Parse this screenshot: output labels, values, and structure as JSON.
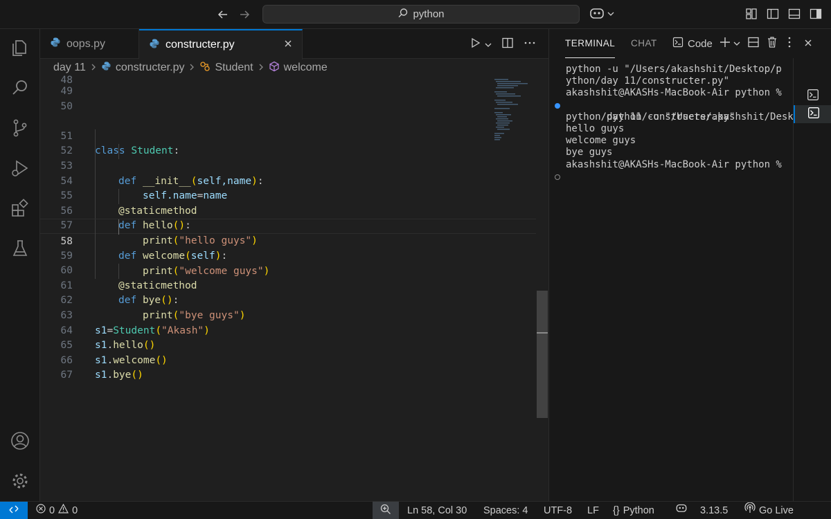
{
  "titlebar": {
    "search_text": "python",
    "back_icon": "arrow-left-icon",
    "forward_icon": "arrow-right-icon"
  },
  "activity_bar": {
    "items": [
      "explorer-icon",
      "search-icon",
      "source-control-icon",
      "run-debug-icon",
      "extensions-icon",
      "testing-icon"
    ],
    "bottom": [
      "account-icon",
      "settings-gear-icon"
    ]
  },
  "tabs": [
    {
      "label": "oops.py",
      "active": false
    },
    {
      "label": "constructer.py",
      "active": true
    }
  ],
  "breadcrumb": {
    "folder": "day 11",
    "file": "constructer.py",
    "class": "Student",
    "method": "welcome"
  },
  "editor": {
    "current_line": 58,
    "line_numbers": [
      "48",
      "49",
      "50",
      "51",
      "52",
      "53",
      "54",
      "55",
      "56",
      "57",
      "58",
      "59",
      "60",
      "61",
      "62",
      "63",
      "64",
      "65",
      "66",
      "67"
    ],
    "code": {
      "l51_kw": "class",
      "l51_cls": "Student",
      "l51_colon": ":",
      "l52_kw": "def",
      "l52_fn": "__init__",
      "l52_params": "self,name",
      "l53_lhs": "self.name",
      "l53_eq": "=",
      "l53_rhs": "name",
      "l54_dec": "@staticmethod",
      "l55_kw": "def",
      "l55_fn": "hello",
      "l56_fn": "print",
      "l56_str": "\"hello guys\"",
      "l57_kw": "def",
      "l57_fn": "welcome",
      "l57_param": "self",
      "l58_fn": "print",
      "l58_str": "\"welcome guys\"",
      "l59_dec": "@staticmethod",
      "l60_kw": "def",
      "l60_fn": "bye",
      "l61_fn": "print",
      "l61_str": "\"bye guys\"",
      "l63_var": "s1",
      "l63_cls": "Student",
      "l63_str": "\"Akash\"",
      "l64_var": "s1",
      "l64_fn": "hello",
      "l65_var": "s1",
      "l65_fn": "welcome",
      "l66_var": "s1",
      "l66_fn": "bye"
    }
  },
  "panel": {
    "tabs": [
      "TERMINAL",
      "CHAT"
    ],
    "terminal_profile": "Code",
    "terminal_lines": [
      "python -u \"/Users/akashshit/Desktop/p",
      "ython/day 11/constructer.py\"",
      "akashshit@AKASHs-MacBook-Air python %",
      " python -u \"/Users/akashshit/Desktop/",
      "python/day 11/constructer.py\"",
      "hello guys",
      "welcome guys",
      "bye guys",
      "akashshit@AKASHs-MacBook-Air python %"
    ]
  },
  "statusbar": {
    "errors": "0",
    "warnings": "0",
    "cursor": "Ln 58, Col 30",
    "spaces": "Spaces: 4",
    "encoding": "UTF-8",
    "eol": "LF",
    "language": "Python",
    "version": "3.13.5",
    "golive": "Go Live",
    "brace_glyph": "{}"
  },
  "colors": {
    "accent": "#0078d4",
    "keyword": "#569cd6",
    "class": "#4ec9b0",
    "function": "#dcdcaa",
    "variable": "#9cdcfe",
    "string": "#ce9178"
  }
}
